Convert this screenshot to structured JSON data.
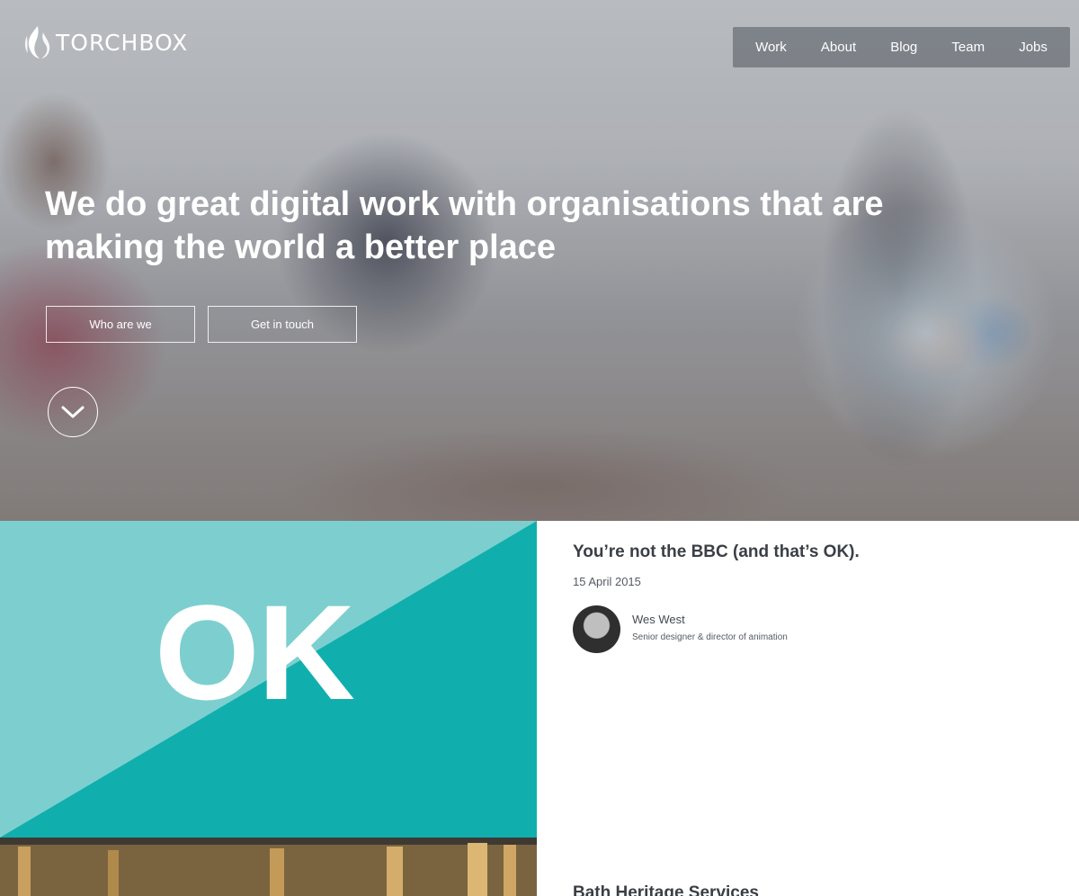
{
  "brand": {
    "name": "TORCHBOX"
  },
  "nav": {
    "items": [
      {
        "label": "Work"
      },
      {
        "label": "About"
      },
      {
        "label": "Blog"
      },
      {
        "label": "Team"
      },
      {
        "label": "Jobs"
      }
    ]
  },
  "hero": {
    "title": "We do great digital work with organisations that are making the world a better place",
    "buttons": {
      "who_are_we": "Who are we",
      "get_in_touch": "Get in touch"
    },
    "scroll_icon": "chevron-down-icon"
  },
  "featured": {
    "tile_text": "OK",
    "tile_colors": {
      "light": "#7dcfcf",
      "dark": "#10afae"
    },
    "title": "You’re not the BBC (and that’s OK).",
    "date": "15 April 2015",
    "author": {
      "name": "Wes West",
      "role": "Senior designer & director of animation"
    }
  },
  "next": {
    "title": "Bath Heritage Services"
  }
}
